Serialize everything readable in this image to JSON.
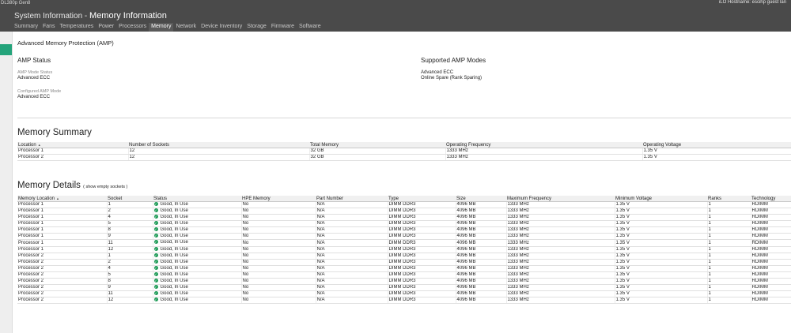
{
  "header": {
    "server_name": "DL380p Gen8",
    "ilo_hostname": "iLO Hostname: escihp guest lan",
    "title_prefix": "System Information - ",
    "title_main": "Memory Information"
  },
  "tabs": [
    {
      "label": "Summary"
    },
    {
      "label": "Fans"
    },
    {
      "label": "Temperatures"
    },
    {
      "label": "Power"
    },
    {
      "label": "Processors"
    },
    {
      "label": "Memory",
      "active": true
    },
    {
      "label": "Network"
    },
    {
      "label": "Device Inventory"
    },
    {
      "label": "Storage"
    },
    {
      "label": "Firmware"
    },
    {
      "label": "Software"
    }
  ],
  "amp": {
    "section_title": "Advanced Memory Protection (AMP)",
    "status_title": "AMP Status",
    "mode_status_label": "AMP Mode Status",
    "mode_status_value": "Advanced ECC",
    "configured_label": "Configured AMP Mode",
    "configured_value": "Advanced ECC",
    "supported_title": "Supported AMP Modes",
    "supported_modes": [
      "Advanced ECC",
      "Online Spare (Rank Sparing)"
    ]
  },
  "memory_summary": {
    "title": "Memory Summary",
    "columns": [
      "Location",
      "Number of Sockets",
      "Total Memory",
      "Operating Frequency",
      "Operating Voltage"
    ],
    "rows": [
      [
        "Processor 1",
        "12",
        "32 GB",
        "1333 MHz",
        "1.35 V"
      ],
      [
        "Processor 2",
        "12",
        "32 GB",
        "1333 MHz",
        "1.35 V"
      ]
    ]
  },
  "memory_details": {
    "title": "Memory Details",
    "show_empty_link": "( show empty sockets )",
    "columns": [
      "Memory Location",
      "Socket",
      "Status",
      "HPE Memory",
      "Part Number",
      "Type",
      "Size",
      "Maximum Frequency",
      "Minimum Voltage",
      "Ranks",
      "Technology"
    ],
    "rows": [
      [
        "Processor 1",
        "1",
        "Good, In Use",
        "No",
        "N/A",
        "DIMM DDR3",
        "4096 MB",
        "1333 MHz",
        "1.35 V",
        "1",
        "RDIMM"
      ],
      [
        "Processor 1",
        "2",
        "Good, In Use",
        "No",
        "N/A",
        "DIMM DDR3",
        "4096 MB",
        "1333 MHz",
        "1.35 V",
        "1",
        "RDIMM"
      ],
      [
        "Processor 1",
        "4",
        "Good, In Use",
        "No",
        "N/A",
        "DIMM DDR3",
        "4096 MB",
        "1333 MHz",
        "1.35 V",
        "1",
        "RDIMM"
      ],
      [
        "Processor 1",
        "5",
        "Good, In Use",
        "No",
        "N/A",
        "DIMM DDR3",
        "4096 MB",
        "1333 MHz",
        "1.35 V",
        "1",
        "RDIMM"
      ],
      [
        "Processor 1",
        "8",
        "Good, In Use",
        "No",
        "N/A",
        "DIMM DDR3",
        "4096 MB",
        "1333 MHz",
        "1.35 V",
        "1",
        "RDIMM"
      ],
      [
        "Processor 1",
        "9",
        "Good, In Use",
        "No",
        "N/A",
        "DIMM DDR3",
        "4096 MB",
        "1333 MHz",
        "1.35 V",
        "1",
        "RDIMM"
      ],
      [
        "Processor 1",
        "11",
        "Good, In Use",
        "No",
        "N/A",
        "DIMM DDR3",
        "4096 MB",
        "1333 MHz",
        "1.35 V",
        "1",
        "RDIMM"
      ],
      [
        "Processor 1",
        "12",
        "Good, In Use",
        "No",
        "N/A",
        "DIMM DDR3",
        "4096 MB",
        "1333 MHz",
        "1.35 V",
        "1",
        "RDIMM"
      ],
      [
        "Processor 2",
        "1",
        "Good, In Use",
        "No",
        "N/A",
        "DIMM DDR3",
        "4096 MB",
        "1333 MHz",
        "1.35 V",
        "1",
        "RDIMM"
      ],
      [
        "Processor 2",
        "2",
        "Good, In Use",
        "No",
        "N/A",
        "DIMM DDR3",
        "4096 MB",
        "1333 MHz",
        "1.35 V",
        "1",
        "RDIMM"
      ],
      [
        "Processor 2",
        "4",
        "Good, In Use",
        "No",
        "N/A",
        "DIMM DDR3",
        "4096 MB",
        "1333 MHz",
        "1.35 V",
        "1",
        "RDIMM"
      ],
      [
        "Processor 2",
        "5",
        "Good, In Use",
        "No",
        "N/A",
        "DIMM DDR3",
        "4096 MB",
        "1333 MHz",
        "1.35 V",
        "1",
        "RDIMM"
      ],
      [
        "Processor 2",
        "8",
        "Good, In Use",
        "No",
        "N/A",
        "DIMM DDR3",
        "4096 MB",
        "1333 MHz",
        "1.35 V",
        "1",
        "RDIMM"
      ],
      [
        "Processor 2",
        "9",
        "Good, In Use",
        "No",
        "N/A",
        "DIMM DDR3",
        "4096 MB",
        "1333 MHz",
        "1.35 V",
        "1",
        "RDIMM"
      ],
      [
        "Processor 2",
        "11",
        "Good, In Use",
        "No",
        "N/A",
        "DIMM DDR3",
        "4096 MB",
        "1333 MHz",
        "1.35 V",
        "1",
        "RDIMM"
      ],
      [
        "Processor 2",
        "12",
        "Good, In Use",
        "No",
        "N/A",
        "DIMM DDR3",
        "4096 MB",
        "1333 MHz",
        "1.35 V",
        "1",
        "RDIMM"
      ]
    ]
  },
  "colors": {
    "header_bg": "#4a4a4a",
    "accent": "#24a47b",
    "status_ok": "#1e9b57"
  }
}
